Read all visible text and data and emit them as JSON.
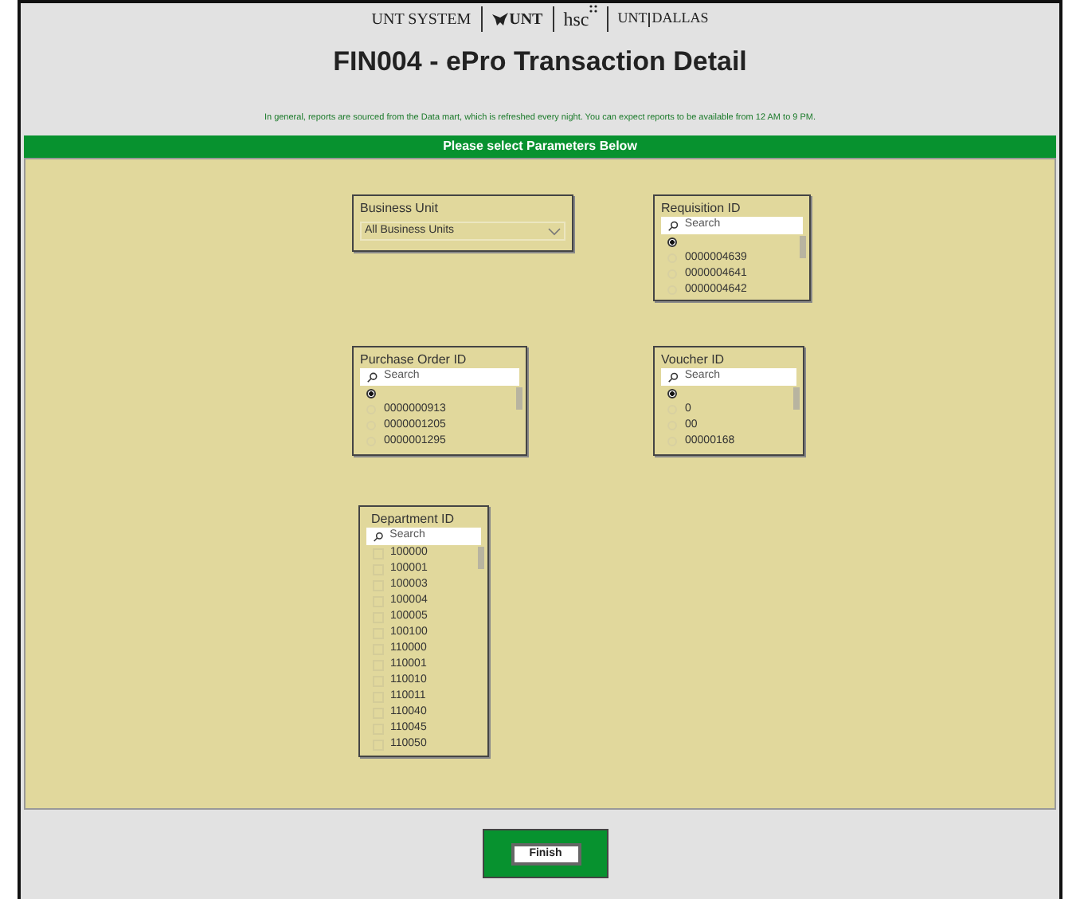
{
  "logos": [
    "UNT SYSTEM",
    "UNT",
    "hsc",
    "UNT",
    "DALLAS"
  ],
  "title": "FIN004 - ePro Transaction Detail",
  "notice": "In general, reports are sourced from the Data mart, which is refreshed every night. You can expect reports to be available from 12 AM to 9 PM.",
  "banner": "Please select Parameters Below",
  "business_unit": {
    "label": "Business Unit",
    "value": "All Business Units"
  },
  "requisition": {
    "label": "Requisition ID",
    "placeholder": "Search",
    "items": [
      {
        "selected": true
      },
      {
        "label": "0000004639",
        "selected": false
      },
      {
        "label": "0000004641",
        "selected": false
      },
      {
        "label": "0000004642",
        "selected": false
      }
    ]
  },
  "purchase_order": {
    "label": "Purchase Order ID",
    "placeholder": "Search",
    "items": [
      {
        "selected": true
      },
      {
        "label": "0000000913",
        "selected": false
      },
      {
        "label": "0000001205",
        "selected": false
      },
      {
        "label": "0000001295",
        "selected": false
      }
    ]
  },
  "voucher": {
    "label": "Voucher ID",
    "placeholder": "Search",
    "items": [
      {
        "selected": true
      },
      {
        "label": "0",
        "selected": false
      },
      {
        "label": "00",
        "selected": false
      },
      {
        "label": "00000168",
        "selected": false
      }
    ]
  },
  "department": {
    "label": "Department ID",
    "placeholder": "Search",
    "items": [
      {
        "label": "100000",
        "checked": false
      },
      {
        "label": "100001",
        "checked": false
      },
      {
        "label": "100003",
        "checked": false
      },
      {
        "label": "100004",
        "checked": false
      },
      {
        "label": "100005",
        "checked": false
      },
      {
        "label": "100100",
        "checked": false
      },
      {
        "label": "110000",
        "checked": false
      },
      {
        "label": "110001",
        "checked": false
      },
      {
        "label": "110010",
        "checked": false
      },
      {
        "label": "110011",
        "checked": false
      },
      {
        "label": "110040",
        "checked": false
      },
      {
        "label": "110045",
        "checked": false
      },
      {
        "label": "110050",
        "checked": false
      }
    ]
  },
  "finish_button": "Finish"
}
